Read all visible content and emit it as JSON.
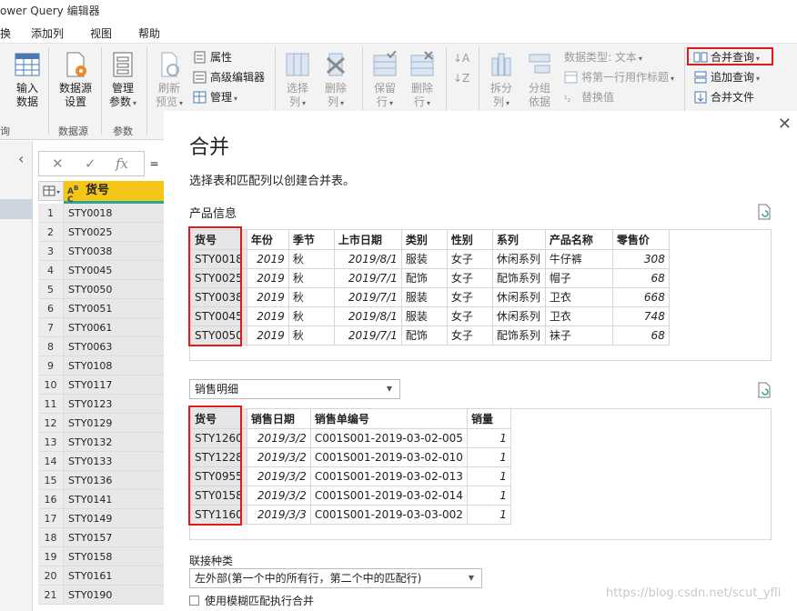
{
  "window": {
    "title": "ower Query 编辑器"
  },
  "menu": {
    "items": [
      "换",
      "添加列",
      "视图",
      "帮助"
    ]
  },
  "ribbon": {
    "input_data": {
      "line1": "输入",
      "line2": "数据"
    },
    "data_source_settings": {
      "line1": "数据源",
      "line2": "设置"
    },
    "manage_params": {
      "line1": "管理",
      "line2": "参数"
    },
    "refresh_preview": {
      "line1": "刷新",
      "line2": "预览"
    },
    "properties": "属性",
    "advanced_editor": "高级编辑器",
    "manage": "管理",
    "choose_columns": {
      "line1": "选择",
      "line2": "列"
    },
    "remove_columns": {
      "line1": "删除",
      "line2": "列"
    },
    "keep_rows": {
      "line1": "保留",
      "line2": "行"
    },
    "remove_rows": {
      "line1": "删除",
      "line2": "行"
    },
    "split_column": {
      "line1": "拆分",
      "line2": "列"
    },
    "group_by": {
      "line1": "分组",
      "line2": "依据"
    },
    "data_type": "数据类型: 文本",
    "first_row_header": "将第一行用作标题",
    "replace_values": "替换值",
    "merge_queries": "合并查询",
    "append_queries": "追加查询",
    "combine_files": "合并文件",
    "groups": {
      "query": "询",
      "data_source": "数据源",
      "params": "参数"
    }
  },
  "query_grid": {
    "column": "货号",
    "rows": [
      {
        "idx": "1",
        "val": "STY0018"
      },
      {
        "idx": "2",
        "val": "STY0025"
      },
      {
        "idx": "3",
        "val": "STY0038"
      },
      {
        "idx": "4",
        "val": "STY0045"
      },
      {
        "idx": "5",
        "val": "STY0050"
      },
      {
        "idx": "6",
        "val": "STY0051"
      },
      {
        "idx": "7",
        "val": "STY0061"
      },
      {
        "idx": "8",
        "val": "STY0063"
      },
      {
        "idx": "9",
        "val": "STY0108"
      },
      {
        "idx": "10",
        "val": "STY0117"
      },
      {
        "idx": "11",
        "val": "STY0123"
      },
      {
        "idx": "12",
        "val": "STY0129"
      },
      {
        "idx": "13",
        "val": "STY0132"
      },
      {
        "idx": "14",
        "val": "STY0133"
      },
      {
        "idx": "15",
        "val": "STY0136"
      },
      {
        "idx": "16",
        "val": "STY0141"
      },
      {
        "idx": "17",
        "val": "STY0149"
      },
      {
        "idx": "18",
        "val": "STY0157"
      },
      {
        "idx": "19",
        "val": "STY0158"
      },
      {
        "idx": "20",
        "val": "STY0161"
      },
      {
        "idx": "21",
        "val": "STY0190"
      }
    ]
  },
  "dialog": {
    "title": "合并",
    "subtitle": "选择表和匹配列以创建合并表。",
    "table1": {
      "name": "产品信息",
      "headers": [
        "货号",
        "年份",
        "季节",
        "上市日期",
        "类别",
        "性别",
        "系列",
        "产品名称",
        "零售价"
      ],
      "rows": [
        [
          "STY0018",
          "2019",
          "秋",
          "2019/8/1",
          "服装",
          "女子",
          "休闲系列",
          "牛仔裤",
          "308"
        ],
        [
          "STY0025",
          "2019",
          "秋",
          "2019/7/1",
          "配饰",
          "女子",
          "配饰系列",
          "帽子",
          "68"
        ],
        [
          "STY0038",
          "2019",
          "秋",
          "2019/7/1",
          "服装",
          "女子",
          "休闲系列",
          "卫衣",
          "668"
        ],
        [
          "STY0045",
          "2019",
          "秋",
          "2019/8/1",
          "服装",
          "女子",
          "休闲系列",
          "卫衣",
          "748"
        ],
        [
          "STY0050",
          "2019",
          "秋",
          "2019/7/1",
          "配饰",
          "女子",
          "配饰系列",
          "袜子",
          "68"
        ]
      ]
    },
    "table2": {
      "name": "销售明细",
      "headers": [
        "货号",
        "销售日期",
        "销售单编号",
        "销量"
      ],
      "rows": [
        [
          "STY1260",
          "2019/3/2",
          "C001S001-2019-03-02-005",
          "1"
        ],
        [
          "STY1228",
          "2019/3/2",
          "C001S001-2019-03-02-010",
          "1"
        ],
        [
          "STY0955",
          "2019/3/2",
          "C001S001-2019-03-02-013",
          "1"
        ],
        [
          "STY0158",
          "2019/3/2",
          "C001S001-2019-03-02-014",
          "1"
        ],
        [
          "STY1160",
          "2019/3/3",
          "C001S001-2019-03-03-002",
          "1"
        ]
      ]
    },
    "join_kind_label": "联接种类",
    "join_kind_value": "左外部(第一个中的所有行，第二个中的匹配行)",
    "fuzzy_label": "使用模糊匹配执行合并"
  },
  "watermark": "https://blog.csdn.net/scut_yfli",
  "colors": {
    "highlight": "#e0191b",
    "column_header": "#f5c518",
    "accent": "#2aa39a"
  }
}
